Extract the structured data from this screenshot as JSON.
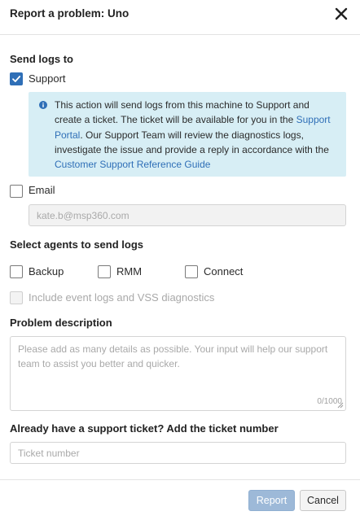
{
  "dialog": {
    "title": "Report a problem: Uno"
  },
  "send_logs": {
    "section_title": "Send logs to",
    "support_label": "Support",
    "support_checked": true,
    "info_part1": "This action will send logs from this machine to Support and create a ticket. The ticket will be available for you in the ",
    "info_link1": "Support Portal",
    "info_part2": ". Our Support Team will review the diagnostics logs, investigate the issue and provide a reply in accordance with the ",
    "info_link2": "Customer Support Reference Guide",
    "email_label": "Email",
    "email_checked": false,
    "email_value": "kate.b@msp360.com"
  },
  "agents": {
    "section_title": "Select agents to send logs",
    "backup_label": "Backup",
    "rmm_label": "RMM",
    "connect_label": "Connect",
    "event_logs_label": "Include event logs and VSS diagnostics"
  },
  "problem": {
    "section_title": "Problem description",
    "placeholder": "Please add as many details as possible. Your input will help our support team to assist you better and quicker.",
    "counter": "0/1000"
  },
  "ticket": {
    "section_title": "Already have a support ticket? Add the ticket number",
    "placeholder": "Ticket number"
  },
  "footer": {
    "report_label": "Report",
    "cancel_label": "Cancel"
  },
  "colors": {
    "accent": "#2f6fb7",
    "info_bg": "#d7eef5",
    "report_disabled": "#9db9d8"
  }
}
